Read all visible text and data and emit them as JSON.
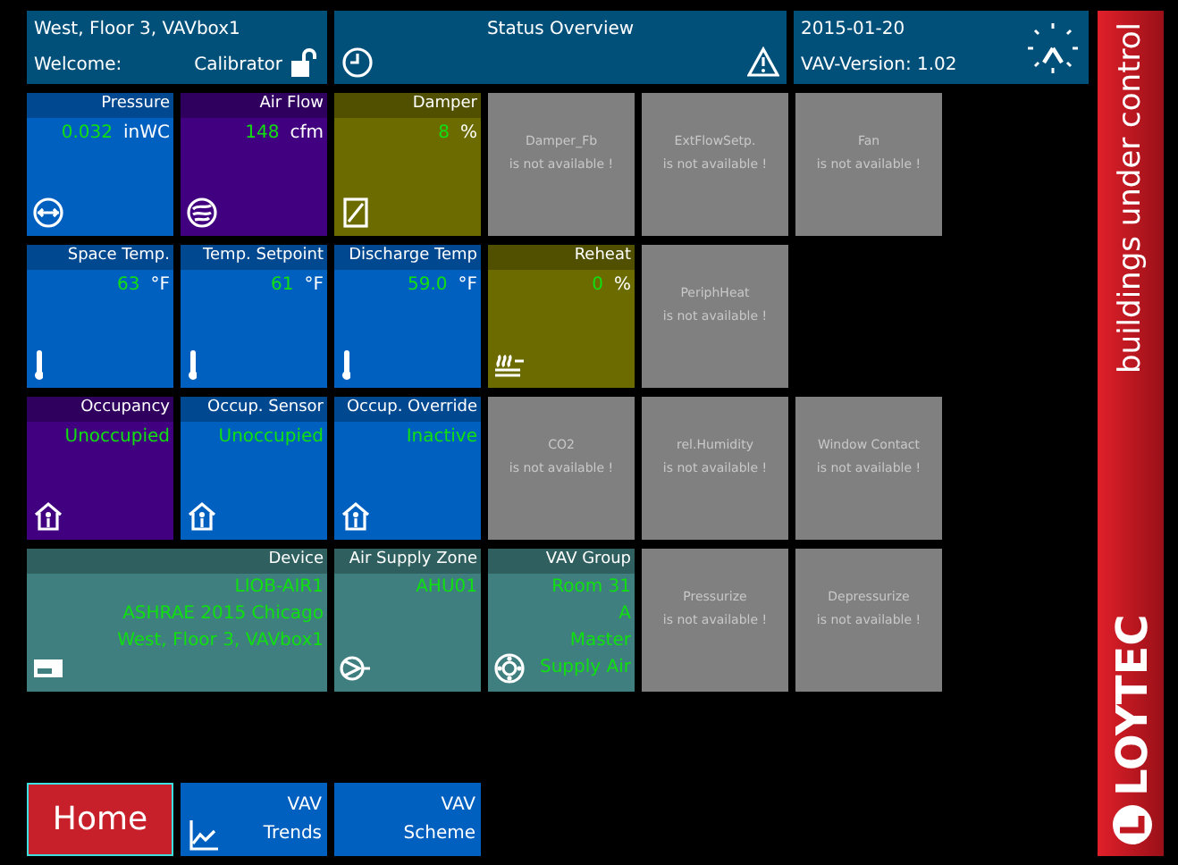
{
  "header": {
    "location": "West, Floor 3, VAVbox1",
    "welcome_label": "Welcome:",
    "user": "Calibrator",
    "title": "Status Overview",
    "date": "2015-01-20",
    "version": "VAV-Version: 1.02"
  },
  "tile_rows": [
    [
      {
        "kind": "value",
        "title": "Pressure",
        "value": "0.032",
        "unit": "inWC",
        "color": "#0060c0"
      },
      {
        "kind": "value",
        "title": "Air Flow",
        "value": "148",
        "unit": "cfm",
        "color": "#40007f"
      },
      {
        "kind": "value",
        "title": "Damper",
        "value": "8",
        "unit": "%",
        "color": "#6b6b00"
      },
      {
        "kind": "unavailable",
        "title": "Damper_Fb",
        "message": "is not available !"
      },
      {
        "kind": "unavailable",
        "title": "ExtFlowSetp.",
        "message": "is not available !"
      },
      {
        "kind": "unavailable",
        "title": "Fan",
        "message": "is not available !"
      }
    ],
    [
      {
        "kind": "value",
        "title": "Space Temp.",
        "value": "63",
        "unit": "°F",
        "color": "#0060c0"
      },
      {
        "kind": "value",
        "title": "Temp. Setpoint",
        "value": "61",
        "unit": "°F",
        "color": "#0060c0"
      },
      {
        "kind": "value",
        "title": "Discharge Temp",
        "value": "59.0",
        "unit": "°F",
        "color": "#0060c0"
      },
      {
        "kind": "value",
        "title": "Reheat",
        "value": "0",
        "unit": "%",
        "color": "#6b6b00"
      },
      {
        "kind": "unavailable",
        "title": "PeriphHeat",
        "message": "is not available !"
      }
    ],
    [
      {
        "kind": "value",
        "title": "Occupancy",
        "value": "Unoccupied",
        "color": "#40007f"
      },
      {
        "kind": "value",
        "title": "Occup. Sensor",
        "value": "Unoccupied",
        "color": "#0060c0"
      },
      {
        "kind": "value",
        "title": "Occup. Override",
        "value": "Inactive",
        "color": "#0060c0"
      },
      {
        "kind": "unavailable",
        "title": "CO2",
        "message": "is not available !"
      },
      {
        "kind": "unavailable",
        "title": "rel.Humidity",
        "message": "is not available !"
      },
      {
        "kind": "unavailable",
        "title": "Window Contact",
        "message": "is not available !"
      }
    ],
    [
      {
        "kind": "device",
        "title": "Device",
        "lines": [
          "LIOB-AIR1",
          "ASHRAE 2015 Chicago",
          "West, Floor 3, VAVbox1"
        ],
        "color": "#3f7f7f"
      },
      {
        "kind": "info",
        "title": "Air Supply Zone",
        "lines": [
          "AHU01"
        ],
        "color": "#3f7f7f"
      },
      {
        "kind": "info",
        "title": "VAV Group",
        "lines": [
          "Room 31",
          "A",
          "Master",
          "Supply Air"
        ],
        "color": "#3f7f7f"
      },
      {
        "kind": "unavailable",
        "title": "Pressurize",
        "message": "is not available !"
      },
      {
        "kind": "unavailable",
        "title": "Depressurize",
        "message": "is not available !"
      }
    ]
  ],
  "nav": [
    {
      "kind": "home",
      "label": "Home"
    },
    {
      "kind": "trends",
      "lines": [
        "VAV",
        "Trends"
      ]
    },
    {
      "kind": "scheme",
      "lines": [
        "VAV",
        "Scheme"
      ]
    }
  ],
  "logo": {
    "brand": "LOYTEC",
    "slogan": "buildings under control"
  }
}
